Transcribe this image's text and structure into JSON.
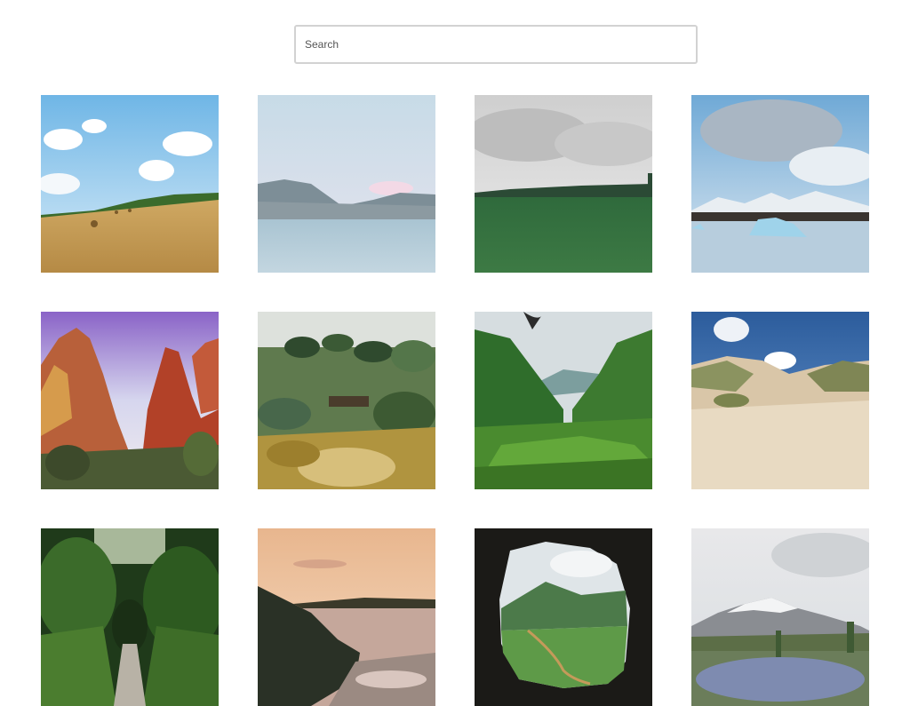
{
  "search": {
    "placeholder": "Search",
    "value": ""
  },
  "gallery": {
    "photos": [
      {
        "name": "wheat-field-hay-bales"
      },
      {
        "name": "pastel-mountain-lake"
      },
      {
        "name": "cloudy-green-meadow"
      },
      {
        "name": "iceberg-lagoon"
      },
      {
        "name": "red-rock-canyon"
      },
      {
        "name": "garden-bench-shrubs"
      },
      {
        "name": "green-valley-grass"
      },
      {
        "name": "sand-dunes-beach-grass"
      },
      {
        "name": "forest-tunnel-path"
      },
      {
        "name": "sunset-rocky-coast"
      },
      {
        "name": "cave-view-valley"
      },
      {
        "name": "snowy-mountain-lupine-field"
      }
    ]
  }
}
